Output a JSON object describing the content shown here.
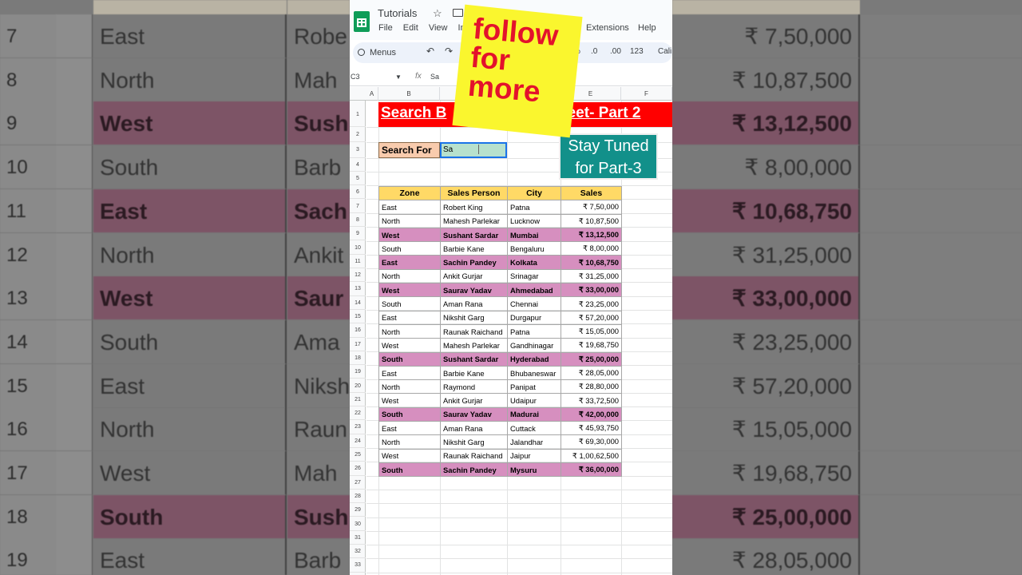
{
  "app": {
    "title": "Tutorials",
    "menus": [
      "File",
      "Edit",
      "View",
      "In"
    ],
    "menu_extensions": "Extensions",
    "menu_help": "Help",
    "toolbar_menus": "Menus",
    "toolbar_right": [
      "%",
      ".0",
      ".00",
      "123",
      "Cali"
    ]
  },
  "formula": {
    "cell_ref": "C3",
    "fx_label": "fx",
    "value": "Sa"
  },
  "columns": [
    "A",
    "B",
    "C",
    "D",
    "E",
    "F"
  ],
  "sheet": {
    "title_left": "Search B",
    "title_right": "heet- Part 2",
    "search_label": "Search For",
    "search_value": "Sa"
  },
  "table": {
    "headers": [
      "Zone",
      "Sales Person",
      "City",
      "Sales"
    ],
    "rows": [
      {
        "row": 7,
        "zone": "East",
        "person": "Robert King",
        "city": "Patna",
        "sales": "₹ 7,50,000",
        "hl": false
      },
      {
        "row": 8,
        "zone": "North",
        "person": "Mahesh Parlekar",
        "city": "Lucknow",
        "sales": "₹ 10,87,500",
        "hl": false
      },
      {
        "row": 9,
        "zone": "West",
        "person": "Sushant Sardar",
        "city": "Mumbai",
        "sales": "₹ 13,12,500",
        "hl": true
      },
      {
        "row": 10,
        "zone": "South",
        "person": "Barbie Kane",
        "city": "Bengaluru",
        "sales": "₹ 8,00,000",
        "hl": false
      },
      {
        "row": 11,
        "zone": "East",
        "person": "Sachin Pandey",
        "city": "Kolkata",
        "sales": "₹ 10,68,750",
        "hl": true
      },
      {
        "row": 12,
        "zone": "North",
        "person": "Ankit Gurjar",
        "city": "Srinagar",
        "sales": "₹ 31,25,000",
        "hl": false
      },
      {
        "row": 13,
        "zone": "West",
        "person": "Saurav Yadav",
        "city": "Ahmedabad",
        "sales": "₹ 33,00,000",
        "hl": true
      },
      {
        "row": 14,
        "zone": "South",
        "person": "Aman Rana",
        "city": "Chennai",
        "sales": "₹ 23,25,000",
        "hl": false
      },
      {
        "row": 15,
        "zone": "East",
        "person": "Nikshit Garg",
        "city": "Durgapur",
        "sales": "₹ 57,20,000",
        "hl": false
      },
      {
        "row": 16,
        "zone": "North",
        "person": "Raunak Raichand",
        "city": "Patna",
        "sales": "₹ 15,05,000",
        "hl": false
      },
      {
        "row": 17,
        "zone": "West",
        "person": "Mahesh Parlekar",
        "city": "Gandhinagar",
        "sales": "₹ 19,68,750",
        "hl": false
      },
      {
        "row": 18,
        "zone": "South",
        "person": "Sushant Sardar",
        "city": "Hyderabad",
        "sales": "₹ 25,00,000",
        "hl": true
      },
      {
        "row": 19,
        "zone": "East",
        "person": "Barbie Kane",
        "city": "Bhubaneswar",
        "sales": "₹ 28,05,000",
        "hl": false
      },
      {
        "row": 20,
        "zone": "North",
        "person": "Raymond",
        "city": "Panipat",
        "sales": "₹ 28,80,000",
        "hl": false
      },
      {
        "row": 21,
        "zone": "West",
        "person": "Ankit Gurjar",
        "city": "Udaipur",
        "sales": "₹ 33,72,500",
        "hl": false
      },
      {
        "row": 22,
        "zone": "South",
        "person": "Saurav Yadav",
        "city": "Madurai",
        "sales": "₹ 42,00,000",
        "hl": true
      },
      {
        "row": 23,
        "zone": "East",
        "person": "Aman Rana",
        "city": "Cuttack",
        "sales": "₹ 45,93,750",
        "hl": false
      },
      {
        "row": 24,
        "zone": "North",
        "person": "Nikshit Garg",
        "city": "Jalandhar",
        "sales": "₹ 69,30,000",
        "hl": false
      },
      {
        "row": 25,
        "zone": "West",
        "person": "Raunak Raichand",
        "city": "Jaipur",
        "sales": "₹ 1,00,62,500",
        "hl": false
      },
      {
        "row": 26,
        "zone": "South",
        "person": "Sachin Pandey",
        "city": "Mysuru",
        "sales": "₹ 36,00,000",
        "hl": true
      }
    ]
  },
  "background_rows": [
    {
      "row": 7,
      "zone": "East",
      "person": "Robe",
      "sales": "₹ 7,50,000",
      "hl": false
    },
    {
      "row": 8,
      "zone": "North",
      "person": "Mah",
      "sales": "₹ 10,87,500",
      "hl": false
    },
    {
      "row": 9,
      "zone": "West",
      "person": "Sush",
      "sales": "₹ 13,12,500",
      "hl": true
    },
    {
      "row": 10,
      "zone": "South",
      "person": "Barb",
      "sales": "₹ 8,00,000",
      "hl": false
    },
    {
      "row": 11,
      "zone": "East",
      "person": "Sach",
      "sales": "₹ 10,68,750",
      "hl": true
    },
    {
      "row": 12,
      "zone": "North",
      "person": "Ankit",
      "sales": "₹ 31,25,000",
      "hl": false
    },
    {
      "row": 13,
      "zone": "West",
      "person": "Saur",
      "sales": "₹ 33,00,000",
      "hl": true
    },
    {
      "row": 14,
      "zone": "South",
      "person": "Ama",
      "sales": "₹ 23,25,000",
      "hl": false
    },
    {
      "row": 15,
      "zone": "East",
      "person": "Niksh",
      "sales": "₹ 57,20,000",
      "hl": false
    },
    {
      "row": 16,
      "zone": "North",
      "person": "Raun",
      "sales": "₹ 15,05,000",
      "hl": false
    },
    {
      "row": 17,
      "zone": "West",
      "person": "Mah",
      "sales": "₹ 19,68,750",
      "hl": false
    },
    {
      "row": 18,
      "zone": "South",
      "person": "Sush",
      "sales": "₹ 25,00,000",
      "hl": true
    },
    {
      "row": 19,
      "zone": "East",
      "person": "Barb",
      "sales": "₹ 28,05,000",
      "hl": false
    }
  ],
  "overlays": {
    "follow_text": [
      "follow",
      "for",
      "more"
    ],
    "stay_tuned": [
      "Stay Tuned",
      "for Part-3"
    ]
  },
  "colors": {
    "title_band": "#ff0000",
    "header_fill": "#ffd966",
    "highlight_fill": "#d68fbf",
    "search_label_fill": "#f8cbad",
    "search_input_fill": "#b7e1cd",
    "sticker_fill": "#faf62e",
    "sticker_text": "#e3122c",
    "stay_tuned_fill": "#12908a"
  },
  "icons": [
    "sheets-logo-icon",
    "star-icon",
    "folder-icon",
    "search-icon",
    "undo-icon",
    "redo-icon",
    "chevron-down-icon",
    "fx-icon"
  ]
}
